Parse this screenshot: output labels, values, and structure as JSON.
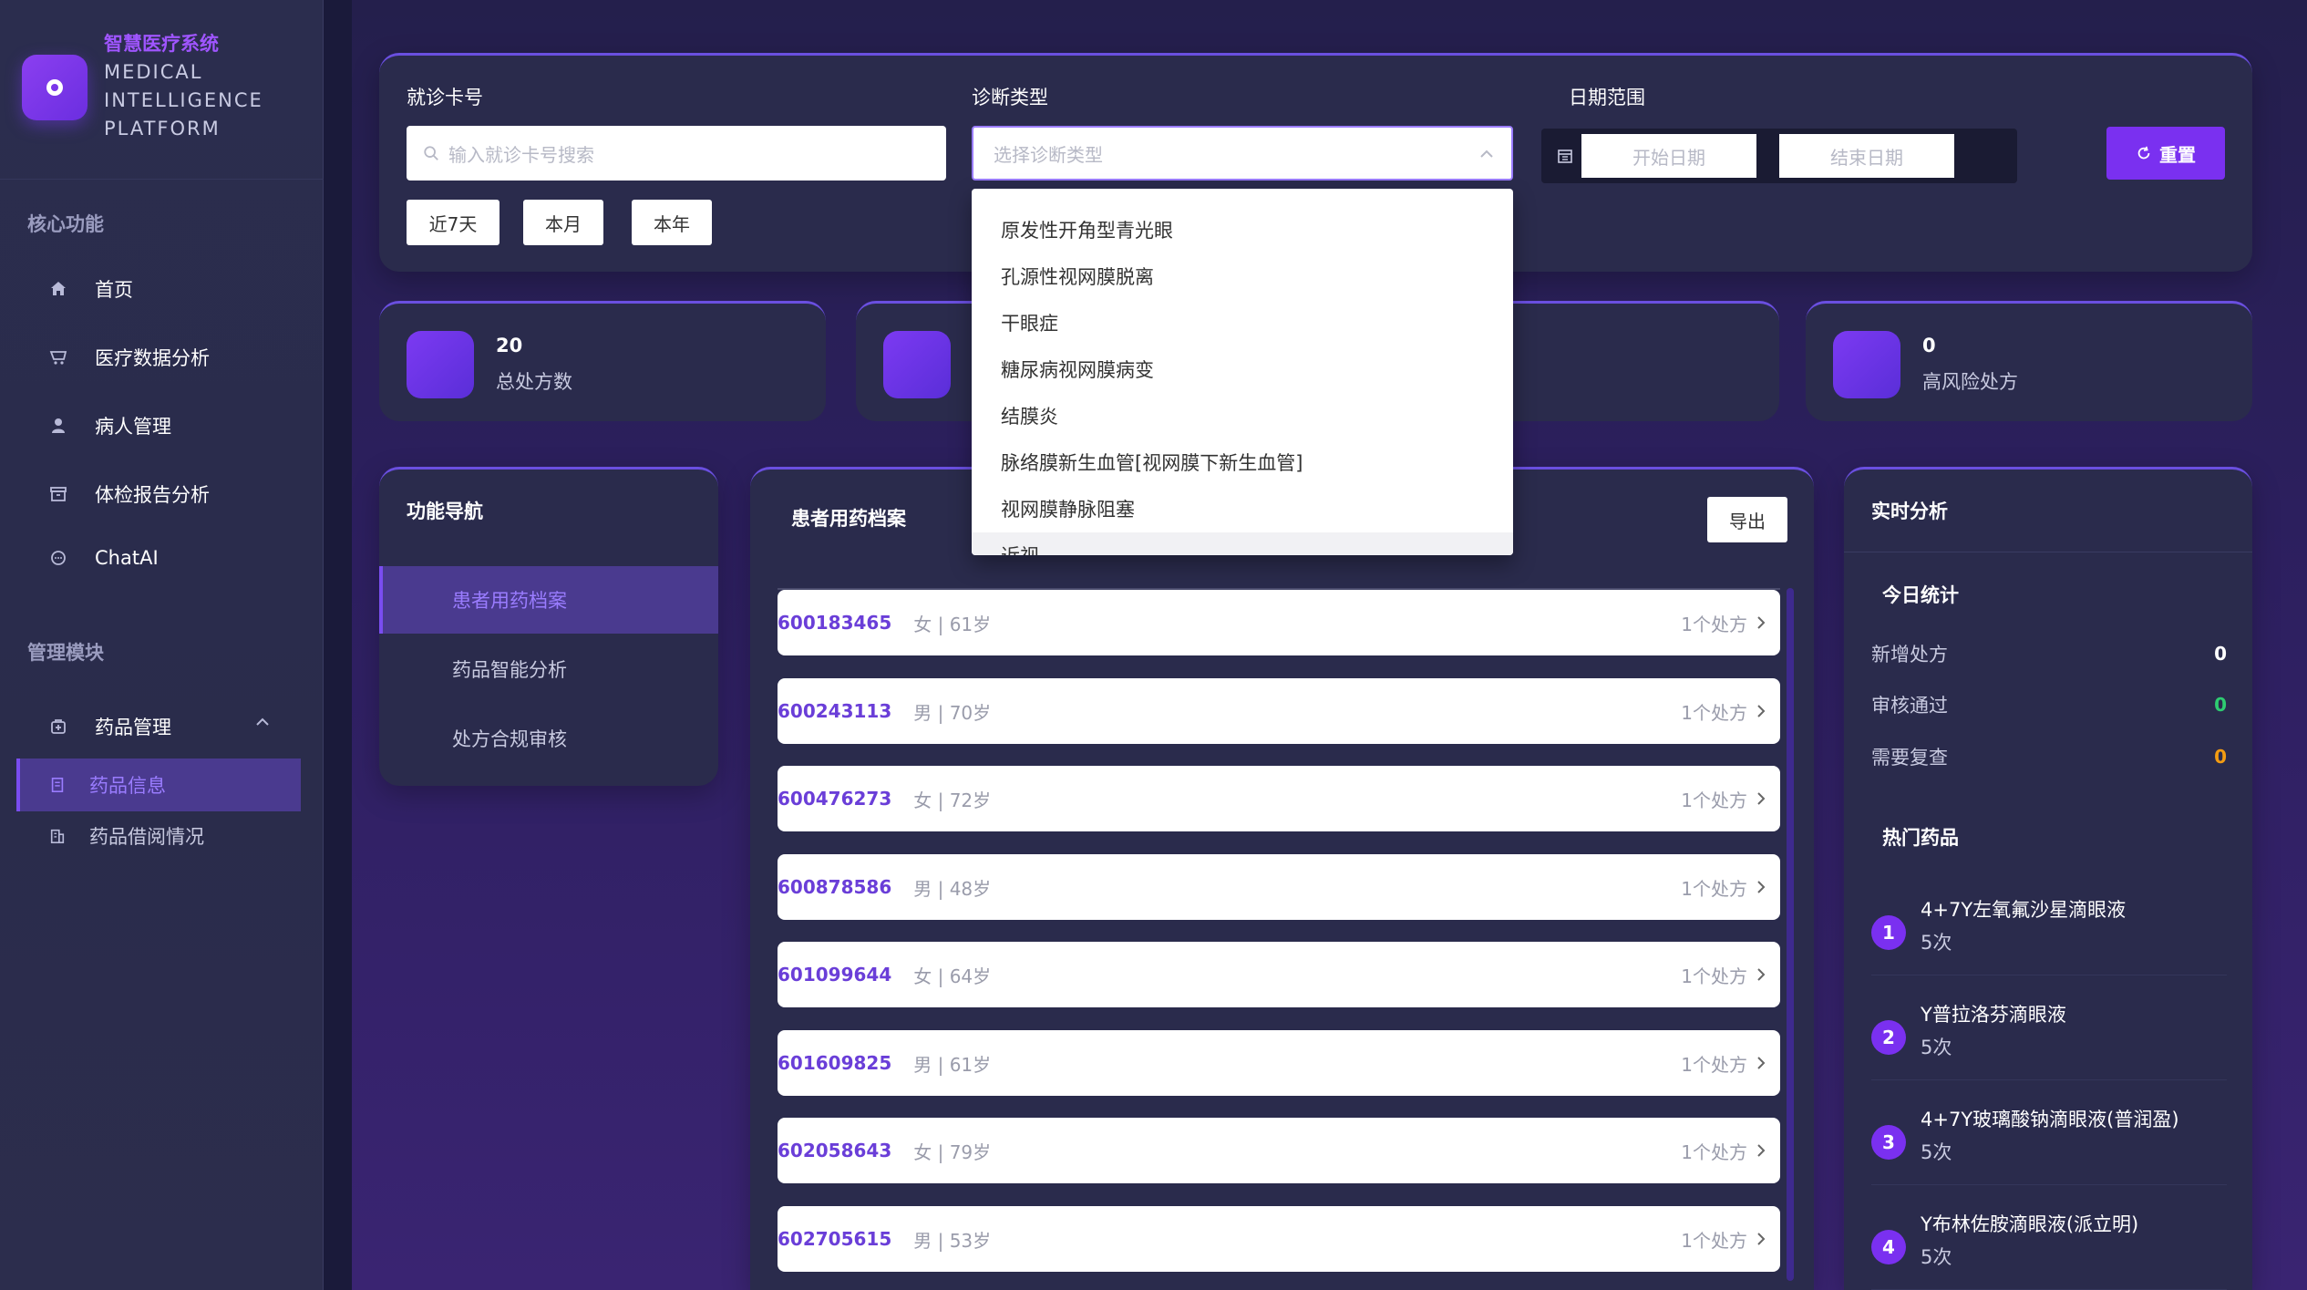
{
  "brand": {
    "name_cn": "智慧医疗系统",
    "name_en_lines": [
      "MEDICAL",
      "INTELLIGENCE",
      "PLATFORM"
    ]
  },
  "sidebar": {
    "section_core": "核心功能",
    "core_items": [
      {
        "label": "首页",
        "icon": "home-icon"
      },
      {
        "label": "医疗数据分析",
        "icon": "cart-icon"
      },
      {
        "label": "病人管理",
        "icon": "user-icon"
      },
      {
        "label": "体检报告分析",
        "icon": "box-icon"
      },
      {
        "label": "ChatAI",
        "icon": "chat-icon"
      }
    ],
    "section_manage": "管理模块",
    "drug_mgmt": {
      "label": "药品管理",
      "icon": "medkit-icon"
    },
    "drug_sub": [
      {
        "label": "药品信息",
        "icon": "document-icon",
        "active": true
      },
      {
        "label": "药品借阅情况",
        "icon": "building-icon",
        "active": false
      }
    ]
  },
  "filters": {
    "card_label": "就诊卡号",
    "card_placeholder": "输入就诊卡号搜索",
    "diag_label": "诊断类型",
    "diag_placeholder": "选择诊断类型",
    "date_label": "日期范围",
    "date_start": "开始日期",
    "date_end": "结束日期",
    "reset": "重置",
    "quick": [
      "近7天",
      "本月",
      "本年"
    ]
  },
  "diag_options": [
    "原发性开角型青光眼",
    "孔源性视网膜脱离",
    "干眼症",
    "糖尿病视网膜病变",
    "结膜炎",
    "脉络膜新生血管[视网膜下新生血管]",
    "视网膜静脉阻塞",
    "近视"
  ],
  "stats": [
    {
      "value": "20",
      "label": "总处方数"
    },
    {
      "value": "0",
      "label": "高风险处方"
    }
  ],
  "fn_nav": {
    "title": "功能导航",
    "items": [
      "患者用药档案",
      "药品智能分析",
      "处方合规审核"
    ]
  },
  "list": {
    "title": "患者用药档案",
    "export": "导出",
    "rows": [
      {
        "card": "600183465",
        "meta": "女 | 61岁",
        "count": "1个处方"
      },
      {
        "card": "600243113",
        "meta": "男 | 70岁",
        "count": "1个处方"
      },
      {
        "card": "600476273",
        "meta": "女 | 72岁",
        "count": "1个处方"
      },
      {
        "card": "600878586",
        "meta": "男 | 48岁",
        "count": "1个处方"
      },
      {
        "card": "601099644",
        "meta": "女 | 64岁",
        "count": "1个处方"
      },
      {
        "card": "601609825",
        "meta": "男 | 61岁",
        "count": "1个处方"
      },
      {
        "card": "602058643",
        "meta": "女 | 79岁",
        "count": "1个处方"
      },
      {
        "card": "602705615",
        "meta": "男 | 53岁",
        "count": "1个处方"
      }
    ]
  },
  "realtime": {
    "title": "实时分析",
    "today_title": "今日统计",
    "today": [
      {
        "label": "新增处方",
        "value": "0",
        "color": "#ffffff"
      },
      {
        "label": "审核通过",
        "value": "0",
        "color": "#2ecc71"
      },
      {
        "label": "需要复查",
        "value": "0",
        "color": "#f39c12"
      }
    ],
    "hot_title": "热门药品",
    "hot": [
      {
        "rank": "1",
        "name": "4+7Y左氧氟沙星滴眼液",
        "times": "5次"
      },
      {
        "rank": "2",
        "name": "Y普拉洛芬滴眼液",
        "times": "5次"
      },
      {
        "rank": "3",
        "name": "4+7Y玻璃酸钠滴眼液(普润盈)",
        "times": "5次"
      },
      {
        "rank": "4",
        "name": "Y布林佐胺滴眼液(派立明)",
        "times": "5次"
      }
    ]
  }
}
